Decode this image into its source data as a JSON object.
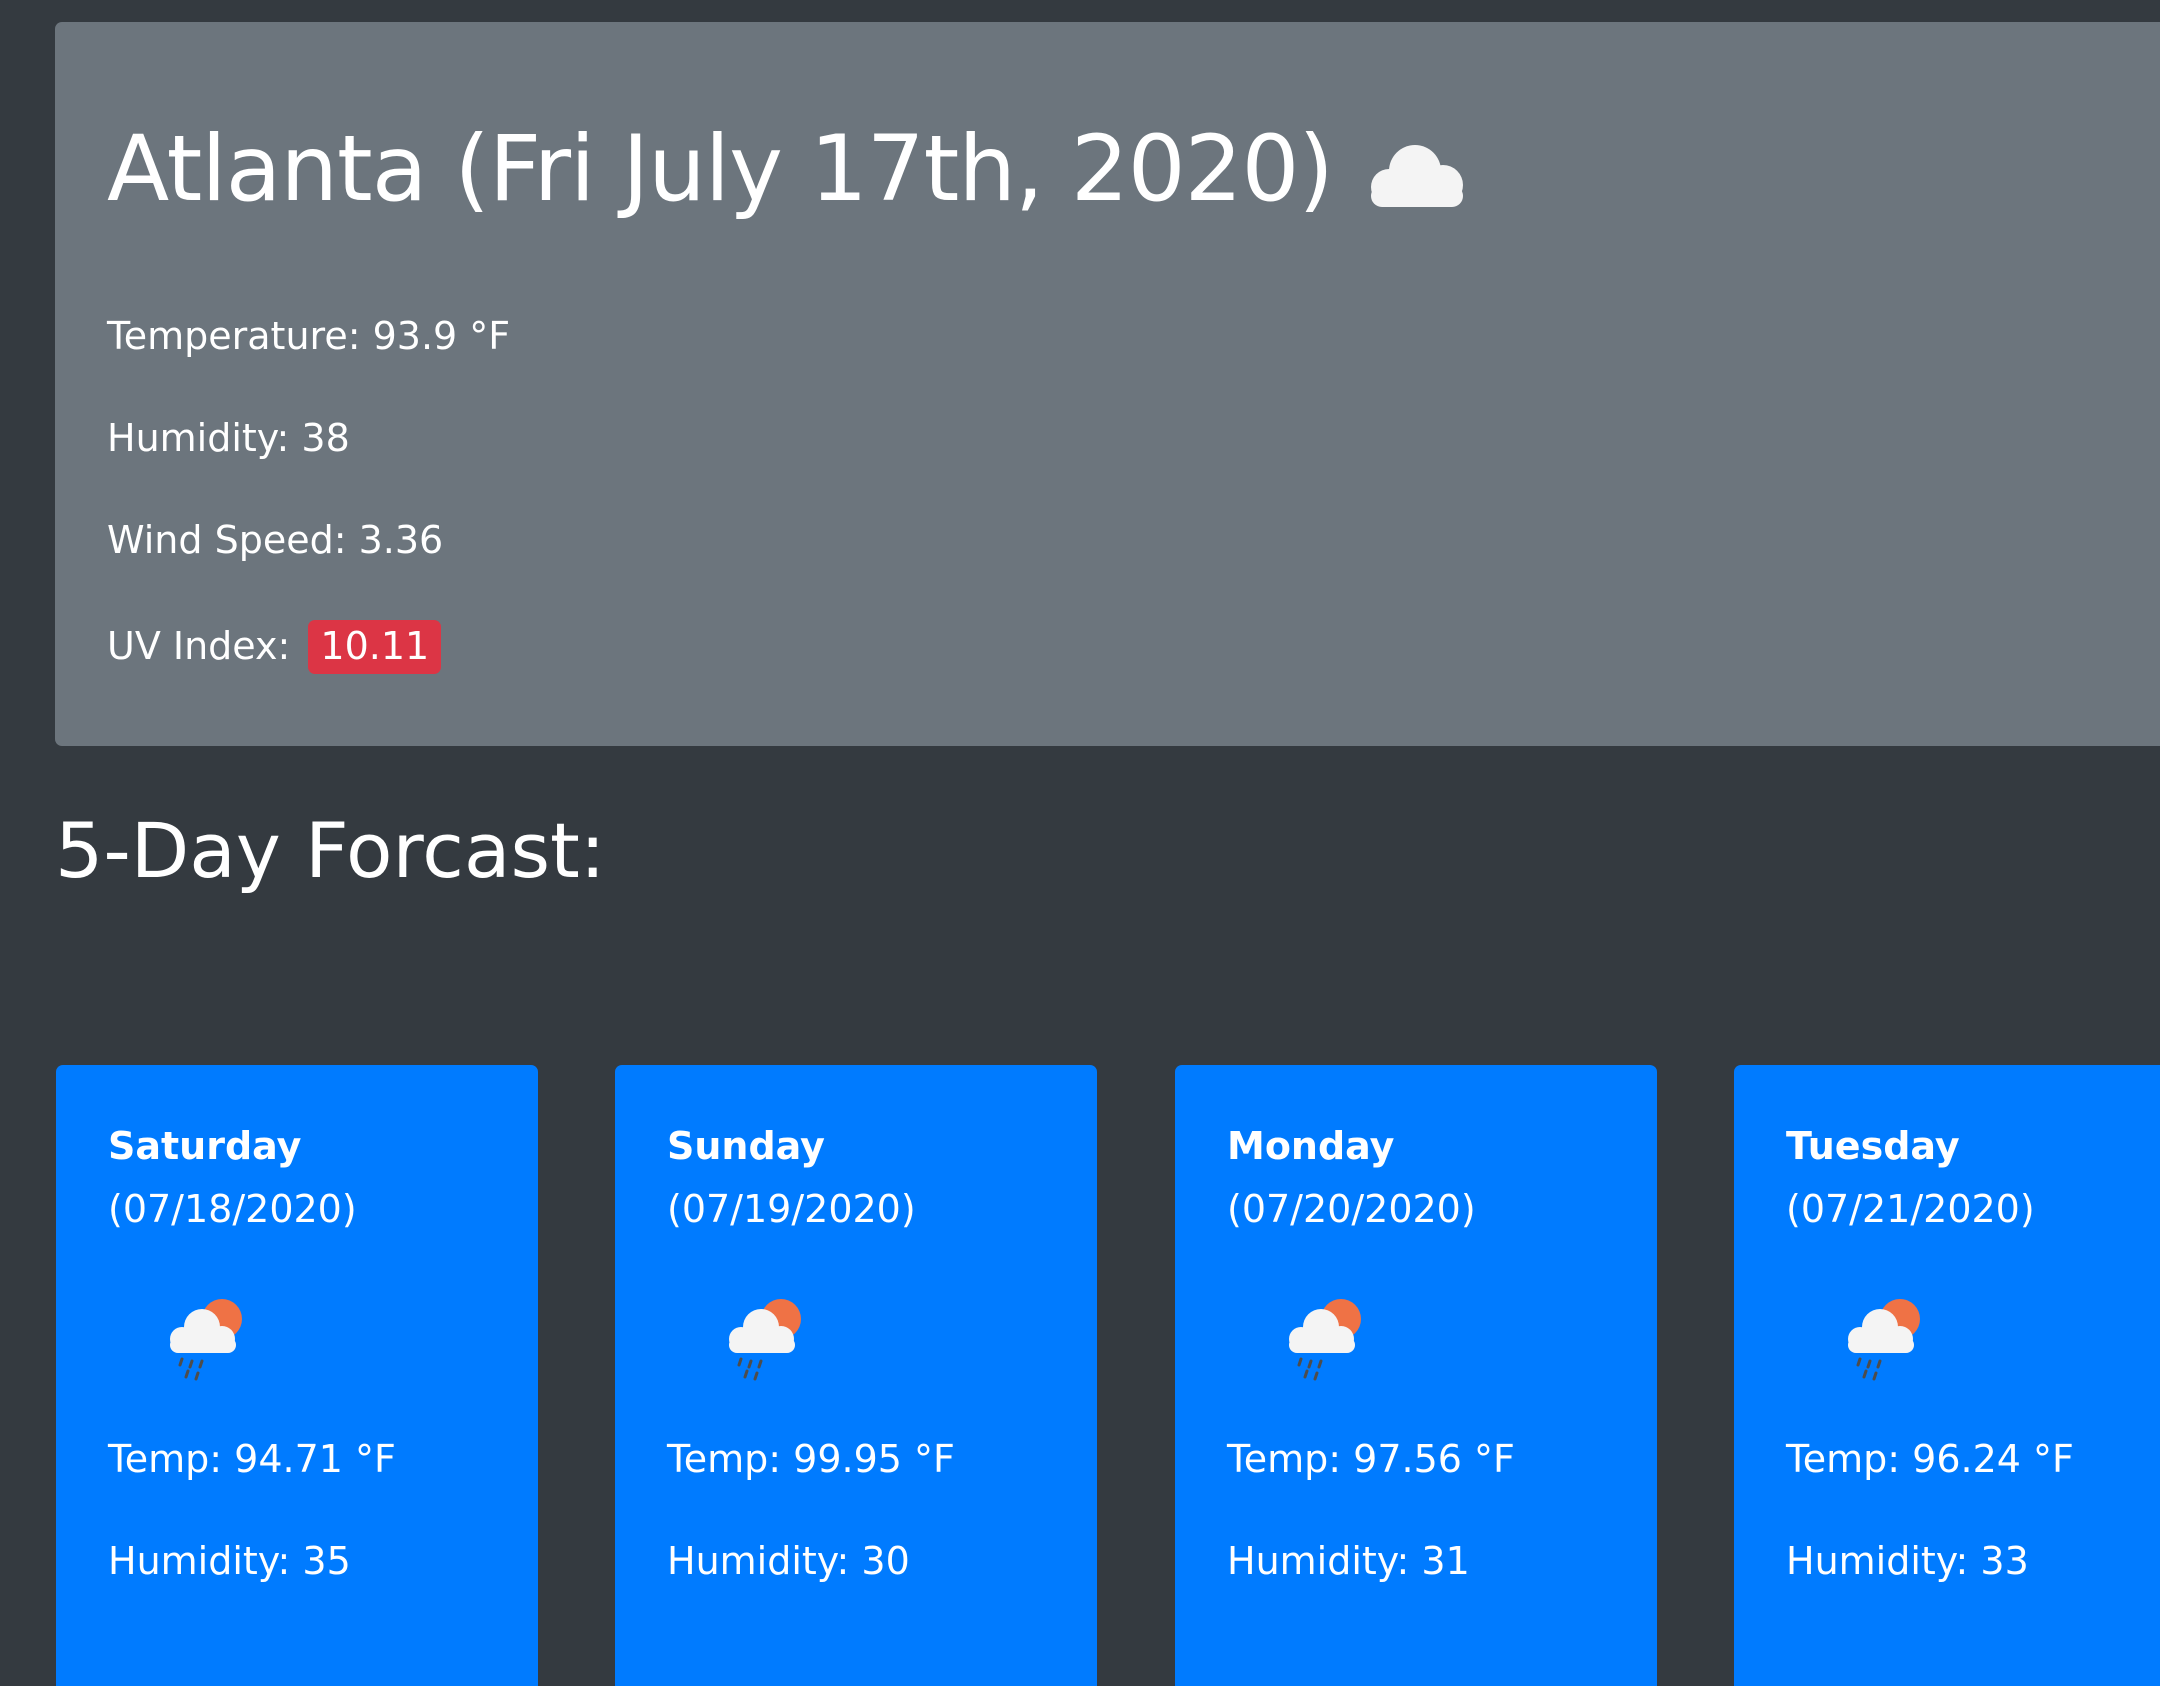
{
  "current": {
    "title": "Atlanta (Fri July 17th, 2020)",
    "icon": "cloud-icon",
    "temperature": "Temperature: 93.9 °F",
    "humidity": "Humidity: 38",
    "wind_speed": "Wind Speed: 3.36",
    "uv_label": "UV Index:",
    "uv_value": "10.11",
    "uv_color": "#dc3545"
  },
  "forecast": {
    "title": "5-Day Forcast:",
    "days": [
      {
        "day": "Saturday",
        "date": "(07/18/2020)",
        "icon": "rain-sun-cloud-icon",
        "temp": "Temp: 94.71 °F",
        "humidity": "Humidity: 35"
      },
      {
        "day": "Sunday",
        "date": "(07/19/2020)",
        "icon": "rain-sun-cloud-icon",
        "temp": "Temp: 99.95 °F",
        "humidity": "Humidity: 30"
      },
      {
        "day": "Monday",
        "date": "(07/20/2020)",
        "icon": "rain-sun-cloud-icon",
        "temp": "Temp: 97.56 °F",
        "humidity": "Humidity: 31"
      },
      {
        "day": "Tuesday",
        "date": "(07/21/2020)",
        "icon": "rain-sun-cloud-icon",
        "temp": "Temp: 96.24 °F",
        "humidity": "Humidity: 33"
      }
    ]
  },
  "colors": {
    "page_background": "#343a40",
    "current_card": "#6c757d",
    "forecast_card": "#007bff"
  }
}
